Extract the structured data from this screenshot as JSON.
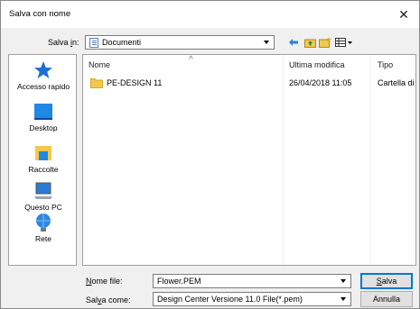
{
  "window": {
    "title": "Salva con nome",
    "close_glyph": "✕"
  },
  "location": {
    "label_pre": "Salva ",
    "label_ul": "i",
    "label_post": "n:",
    "value": "Documenti",
    "toolbar_icons": [
      "back-arrow-icon",
      "up-folder-icon",
      "new-folder-icon",
      "view-menu-icon"
    ]
  },
  "places": [
    {
      "name": "Accesso rapido",
      "icon": "quick-access-icon"
    },
    {
      "name": "Desktop",
      "icon": "desktop-icon"
    },
    {
      "name": "Raccolte",
      "icon": "libraries-icon"
    },
    {
      "name": "Questo PC",
      "icon": "computer-icon"
    },
    {
      "name": "Rete",
      "icon": "network-icon"
    }
  ],
  "columns": {
    "name": "Nome",
    "modified": "Ultima modifica",
    "type": "Tipo",
    "sort_glyph": "^"
  },
  "files": [
    {
      "name": "PE-DESIGN 11",
      "modified": "26/04/2018 11:05",
      "type": "Cartella di",
      "icon": "folder-icon"
    }
  ],
  "filename": {
    "label_ul": "N",
    "label_post": "ome file:",
    "value": "Flower.PEM"
  },
  "filetype": {
    "label_pre": "Sal",
    "label_ul": "v",
    "label_post": "a come:",
    "value": "Design Center Versione 11.0 File(*.pem)"
  },
  "buttons": {
    "save_ul": "S",
    "save_post": "alva",
    "cancel": "Annulla"
  },
  "colors": {
    "accent": "#0078d7",
    "folder": "#f2c94c"
  }
}
